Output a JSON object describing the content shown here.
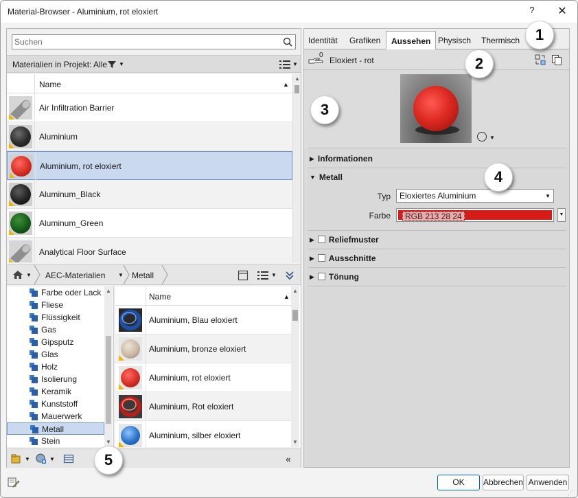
{
  "window": {
    "title": "Material-Browser - Aluminium, rot eloxiert",
    "help_label": "?",
    "close_label": "✕"
  },
  "search": {
    "placeholder": "Suchen",
    "value": ""
  },
  "project": {
    "filter_label": "Materialien in Projekt: Alle"
  },
  "material_list": {
    "column_name": "Name",
    "sort": "ascending",
    "items": [
      {
        "label": "Air Infiltration Barrier",
        "thumb": "grey-cylinder",
        "color": "#9a9a9a"
      },
      {
        "label": "Aluminium",
        "thumb": "dark-sphere",
        "color": "#3a3a3a"
      },
      {
        "label": "Aluminium, rot eloxiert",
        "thumb": "red-sphere",
        "color": "#d62e24",
        "selected": true
      },
      {
        "label": "Aluminum_Black",
        "thumb": "dark-sphere",
        "color": "#2e2e2e"
      },
      {
        "label": "Aluminum_Green",
        "thumb": "green-sphere",
        "color": "#155c18"
      },
      {
        "label": "Analytical Floor Surface",
        "thumb": "grey-cylinder",
        "color": "#9a9a9a"
      }
    ]
  },
  "library": {
    "breadcrumb": [
      "AEC-Materialien",
      "Metall"
    ],
    "tree": [
      {
        "label": "Farbe oder Lack"
      },
      {
        "label": "Fliese"
      },
      {
        "label": "Flüssigkeit"
      },
      {
        "label": "Gas"
      },
      {
        "label": "Gipsputz"
      },
      {
        "label": "Glas"
      },
      {
        "label": "Holz"
      },
      {
        "label": "Isolierung"
      },
      {
        "label": "Keramik"
      },
      {
        "label": "Kunststoff"
      },
      {
        "label": "Mauerwerk"
      },
      {
        "label": "Metall",
        "selected": true
      },
      {
        "label": "Stein"
      }
    ],
    "column_name": "Name",
    "items": [
      {
        "label": "Aluminium, Blau eloxiert",
        "thumb": "blue-torus",
        "color": "#1d4fa8"
      },
      {
        "label": "Aluminium, bronze eloxiert",
        "thumb": "bronze-sphere",
        "color": "#c9b9a6"
      },
      {
        "label": "Aluminium, rot eloxiert",
        "thumb": "red-sphere",
        "color": "#d62e24"
      },
      {
        "label": "Aluminium, Rot eloxiert",
        "thumb": "red-torus",
        "color": "#b3201c"
      },
      {
        "label": "Aluminium, silber eloxiert",
        "thumb": "blue-sphere",
        "color": "#2b73c8"
      }
    ]
  },
  "editor": {
    "tabs": [
      {
        "label": "Identität"
      },
      {
        "label": "Grafiken"
      },
      {
        "label": "Aussehen",
        "active": true
      },
      {
        "label": "Physisch"
      },
      {
        "label": "Thermisch"
      }
    ],
    "asset": {
      "name": "Eloxiert - rot",
      "count": "0"
    },
    "sections": {
      "informationen": "Informationen",
      "metall": "Metall",
      "reliefmuster": "Reliefmuster",
      "ausschnitte": "Ausschnitte",
      "toenung": "Tönung"
    },
    "metal": {
      "type_label": "Typ",
      "type_value": "Eloxiertes Aluminium",
      "color_label": "Farbe",
      "color_value": "RGB 213 28 24",
      "color_hex": "#d51c18"
    }
  },
  "badges": [
    "1",
    "2",
    "3",
    "4",
    "5"
  ],
  "buttons": {
    "ok": "OK",
    "cancel": "Abbrechen",
    "apply": "Anwenden"
  },
  "colors": {
    "selection": "#cbd9ee",
    "selection_border": "#6f97cc",
    "accent": "#0067c0",
    "flag": "#f1b400"
  }
}
